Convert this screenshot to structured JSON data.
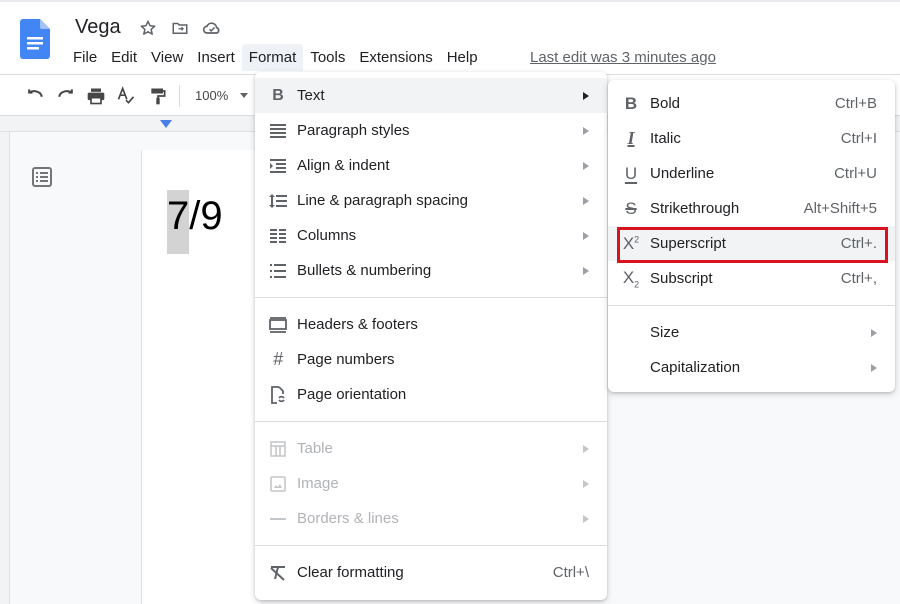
{
  "app": {
    "title": "Vega",
    "last_edit": "Last edit was 3 minutes ago",
    "brand_color": "#4285f4"
  },
  "menubar": [
    "File",
    "Edit",
    "View",
    "Insert",
    "Format",
    "Tools",
    "Extensions",
    "Help"
  ],
  "toolbar": {
    "zoom": "100%"
  },
  "document": {
    "selected_text": "7",
    "rest_text": "/9"
  },
  "format_menu": {
    "items": [
      {
        "label": "Text",
        "icon": "bold-icon",
        "submenu": true,
        "highlighted": true
      },
      {
        "label": "Paragraph styles",
        "icon": "paragraph-styles-icon",
        "submenu": true
      },
      {
        "label": "Align & indent",
        "icon": "indent-icon",
        "submenu": true
      },
      {
        "label": "Line & paragraph spacing",
        "icon": "line-spacing-icon",
        "submenu": true
      },
      {
        "label": "Columns",
        "icon": "columns-icon",
        "submenu": true
      },
      {
        "label": "Bullets & numbering",
        "icon": "bulleted-list-icon",
        "submenu": true
      },
      {
        "label": "Headers & footers",
        "icon": "headers-footers-icon"
      },
      {
        "label": "Page numbers",
        "icon": "hash-icon"
      },
      {
        "label": "Page orientation",
        "icon": "page-orientation-icon"
      },
      {
        "label": "Table",
        "icon": "table-icon",
        "submenu": true,
        "disabled": true
      },
      {
        "label": "Image",
        "icon": "image-icon",
        "submenu": true,
        "disabled": true
      },
      {
        "label": "Borders & lines",
        "icon": "horizontal-line-icon",
        "submenu": true,
        "disabled": true
      },
      {
        "label": "Clear formatting",
        "icon": "clear-formatting-icon",
        "shortcut": "Ctrl+\\"
      }
    ]
  },
  "text_submenu": {
    "items": [
      {
        "label": "Bold",
        "icon": "bold-icon",
        "shortcut": "Ctrl+B"
      },
      {
        "label": "Italic",
        "icon": "italic-icon",
        "shortcut": "Ctrl+I"
      },
      {
        "label": "Underline",
        "icon": "underline-icon",
        "shortcut": "Ctrl+U"
      },
      {
        "label": "Strikethrough",
        "icon": "strikethrough-icon",
        "shortcut": "Alt+Shift+5"
      },
      {
        "label": "Superscript",
        "icon": "superscript-icon",
        "shortcut": "Ctrl+.",
        "highlighted": true,
        "annotated": true
      },
      {
        "label": "Subscript",
        "icon": "subscript-icon",
        "shortcut": "Ctrl+,"
      },
      {
        "label": "Size",
        "submenu": true
      },
      {
        "label": "Capitalization",
        "submenu": true
      }
    ],
    "annotation_color": "#d8121f"
  }
}
